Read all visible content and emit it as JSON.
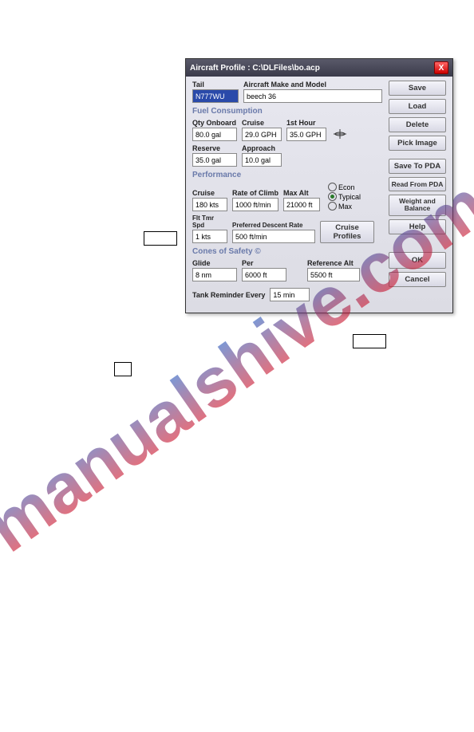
{
  "watermark": "manualshive.com",
  "dialog": {
    "title": "Aircraft Profile : C:\\DLFiles\\bo.acp",
    "tail_label": "Tail",
    "tail_value": "N777WU",
    "make_label": "Aircraft Make and Model",
    "make_value": "beech 36",
    "fuel": {
      "group": "Fuel Consumption",
      "qty_label": "Qty Onboard",
      "qty_value": "80.0 gal",
      "cruise_label": "Cruise",
      "cruise_value": "29.0 GPH",
      "first_label": "1st Hour",
      "first_value": "35.0 GPH",
      "reserve_label": "Reserve",
      "reserve_value": "35.0 gal",
      "approach_label": "Approach",
      "approach_value": "10.0 gal"
    },
    "perf": {
      "group": "Performance",
      "cruise_label": "Cruise",
      "cruise_value": "180 kts",
      "roc_label": "Rate of Climb",
      "roc_value": "1000 ft/min",
      "maxalt_label": "Max Alt",
      "maxalt_value": "21000 ft",
      "flttmr_label": "Flt Tmr Spd",
      "flttmr_value": "1 kts",
      "descent_label": "Preferred Descent Rate",
      "descent_value": "500 ft/min",
      "cruise_profiles": "Cruise Profiles",
      "econ": "Econ",
      "typical": "Typical",
      "max": "Max"
    },
    "cones": {
      "group": "Cones of Safety ©",
      "glide_label": "Glide",
      "glide_value": "8 nm",
      "per_label": "Per",
      "per_value": "6000 ft",
      "ref_label": "Reference Alt",
      "ref_value": "5500 ft"
    },
    "tank_label": "Tank Reminder Every",
    "tank_value": "15 min"
  },
  "buttons": {
    "save": "Save",
    "load": "Load",
    "delete": "Delete",
    "pick": "Pick Image",
    "savepda": "Save To PDA",
    "readpda": "Read From PDA",
    "wb": "Weight and Balance",
    "help": "Help",
    "ok": "OK",
    "cancel": "Cancel"
  }
}
